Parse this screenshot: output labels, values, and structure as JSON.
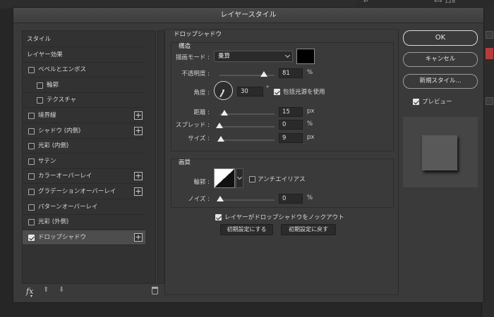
{
  "background": {
    "top_number": "128"
  },
  "dialog": {
    "title": "レイヤースタイル",
    "style_list": [
      {
        "label": "スタイル",
        "checkbox": false,
        "checked": false,
        "plus": false,
        "indent": 0,
        "selected": false
      },
      {
        "label": "レイヤー効果",
        "checkbox": false,
        "checked": false,
        "plus": false,
        "indent": 0,
        "selected": false
      },
      {
        "label": "ベベルとエンボス",
        "checkbox": true,
        "checked": false,
        "plus": false,
        "indent": 0,
        "selected": false
      },
      {
        "label": "輪郭",
        "checkbox": true,
        "checked": false,
        "plus": false,
        "indent": 1,
        "selected": false
      },
      {
        "label": "テクスチャ",
        "checkbox": true,
        "checked": false,
        "plus": false,
        "indent": 1,
        "selected": false
      },
      {
        "label": "境界線",
        "checkbox": true,
        "checked": false,
        "plus": true,
        "indent": 0,
        "selected": false
      },
      {
        "label": "シャドウ (内側)",
        "checkbox": true,
        "checked": false,
        "plus": true,
        "indent": 0,
        "selected": false
      },
      {
        "label": "光彩 (内側)",
        "checkbox": true,
        "checked": false,
        "plus": false,
        "indent": 0,
        "selected": false
      },
      {
        "label": "サテン",
        "checkbox": true,
        "checked": false,
        "plus": false,
        "indent": 0,
        "selected": false
      },
      {
        "label": "カラーオーバーレイ",
        "checkbox": true,
        "checked": false,
        "plus": true,
        "indent": 0,
        "selected": false
      },
      {
        "label": "グラデーションオーバーレイ",
        "checkbox": true,
        "checked": false,
        "plus": true,
        "indent": 0,
        "selected": false
      },
      {
        "label": "パターンオーバーレイ",
        "checkbox": true,
        "checked": false,
        "plus": false,
        "indent": 0,
        "selected": false
      },
      {
        "label": "光彩 (外側)",
        "checkbox": true,
        "checked": false,
        "plus": false,
        "indent": 0,
        "selected": false
      },
      {
        "label": "ドロップシャドウ",
        "checkbox": true,
        "checked": true,
        "plus": true,
        "indent": 0,
        "selected": true
      }
    ],
    "bottom": {
      "fx": "fx",
      "up_arrow": "⬆",
      "down_arrow": "⬇"
    },
    "drop_shadow": {
      "title": "ドロップシャドウ",
      "structure": {
        "title": "構造",
        "blend_mode_label": "描画モード :",
        "blend_mode_value": "乗算",
        "swatch_color": "#000000",
        "opacity_label": "不透明度 :",
        "opacity_value": "81",
        "opacity_fraction": 0.81,
        "opacity_unit": "%",
        "angle_label": "角度 :",
        "angle_value": "30",
        "angle_unit": "°",
        "global_light_label": "包括光源を使用",
        "global_light_checked": true,
        "distance_label": "距離 :",
        "distance_value": "15",
        "distance_unit": "px",
        "spread_label": "スプレッド :",
        "spread_value": "0",
        "spread_unit": "%",
        "size_label": "サイズ :",
        "size_value": "9",
        "size_unit": "px"
      },
      "quality": {
        "title": "画質",
        "contour_label": "輪郭 :",
        "antialias_label": "アンチエイリアス",
        "antialias_checked": false,
        "noise_label": "ノイズ :",
        "noise_value": "0",
        "noise_unit": "%"
      },
      "knockout_label": "レイヤーがドロップシャドウをノックアウト",
      "knockout_checked": true,
      "make_default": "初期設定にする",
      "reset_default": "初期設定に戻す"
    },
    "buttons": {
      "ok": "OK",
      "cancel": "キャンセル",
      "new_style": "新規スタイル...",
      "preview_label": "プレビュー",
      "preview_checked": true
    }
  }
}
